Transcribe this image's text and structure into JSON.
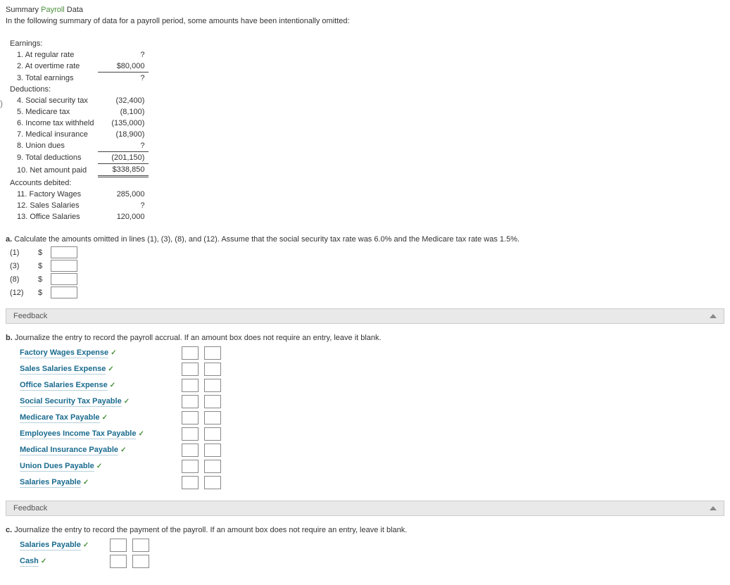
{
  "title": {
    "pre": "Summary ",
    "highlight": "Payroll",
    "post": " Data"
  },
  "intro": "In the following summary of data for a payroll period, some amounts have been intentionally omitted:",
  "table": {
    "earnings_hdr": "Earnings:",
    "r1_label": "1. At regular rate",
    "r1_val": "?",
    "r2_label": "2. At overtime rate",
    "r2_val": "$80,000",
    "r3_label": "3. Total earnings",
    "r3_val": "?",
    "deductions_hdr": "Deductions:",
    "r4_label": "4. Social security tax",
    "r4_val": "(32,400)",
    "r5_label": "5. Medicare tax",
    "r5_val": "(8,100)",
    "r6_label": "6. Income tax withheld",
    "r6_val": "(135,000)",
    "r7_label": "7. Medical insurance",
    "r7_val": "(18,900)",
    "r8_label": "8. Union dues",
    "r8_val": "?",
    "r9_label": "9. Total deductions",
    "r9_val": "(201,150)",
    "r10_label": "10. Net amount paid",
    "r10_val": "$338,850",
    "accounts_hdr": "Accounts debited:",
    "r11_label": "11. Factory Wages",
    "r11_val": "285,000",
    "r12_label": "12. Sales Salaries",
    "r12_val": "?",
    "r13_label": "13. Office Salaries",
    "r13_val": "120,000"
  },
  "a": {
    "label": "a.",
    "text": "Calculate the amounts omitted in lines (1), (3), (8), and (12). Assume that the social security tax rate was 6.0% and the Medicare tax rate was 1.5%.",
    "rows": [
      "(1)",
      "(3)",
      "(8)",
      "(12)"
    ],
    "dollar": "$"
  },
  "b": {
    "label": "b.",
    "text": "Journalize the entry to record the payroll accrual. If an amount box does not require an entry, leave it blank.",
    "accounts": [
      "Factory Wages Expense",
      "Sales Salaries Expense",
      "Office Salaries Expense",
      "Social Security Tax Payable",
      "Medicare Tax Payable",
      "Employees Income Tax Payable",
      "Medical Insurance Payable",
      "Union Dues Payable",
      "Salaries Payable"
    ]
  },
  "c": {
    "label": "c.",
    "text": "Journalize the entry to record the payment of the payroll. If an amount box does not require an entry, leave it blank.",
    "accounts": [
      "Salaries Payable",
      "Cash"
    ]
  },
  "feedback": "Feedback",
  "check": "✓"
}
